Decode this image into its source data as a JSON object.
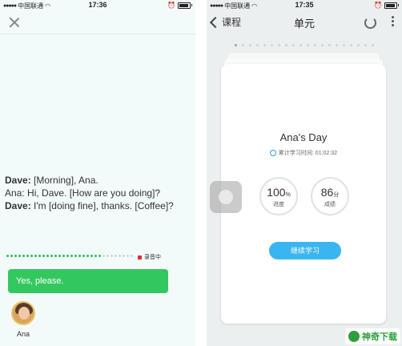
{
  "left_screen": {
    "status": {
      "carrier": "中国联通",
      "time": "17:36"
    },
    "dialogue": [
      {
        "speaker": "Dave:",
        "text": " [Morning], Ana."
      },
      {
        "speaker": "Ana:",
        "text": " Hi, Dave. [How are you doing]?"
      },
      {
        "speaker": "Dave:",
        "text": " I'm [doing fine], thanks. [Coffee]?"
      }
    ],
    "recording_label": "录音中",
    "reply_text": "Yes, please.",
    "avatar_name": "Ana",
    "progress_fraction": 0.75
  },
  "right_screen": {
    "status": {
      "carrier": "中国联通",
      "time": "17:35"
    },
    "back_label": "课程",
    "title": "单元",
    "lesson_title": "Ana's Day",
    "study_time_label": "累计学习时间: 01:02:32",
    "progress": {
      "value": "100",
      "unit": "%",
      "label": "进度"
    },
    "score": {
      "value": "86",
      "unit": "分",
      "label": "成绩"
    },
    "continue_label": "继续学习"
  },
  "watermark": "神奇下载",
  "icons": [
    "close-icon",
    "wifi-icon",
    "battery-icon",
    "alarm-icon",
    "back-chevron-icon",
    "refresh-icon",
    "more-icon",
    "clock-icon",
    "record-icon"
  ],
  "colors": {
    "green": "#33c85f",
    "blue": "#39b5f2",
    "record_red": "#e52e2e"
  }
}
